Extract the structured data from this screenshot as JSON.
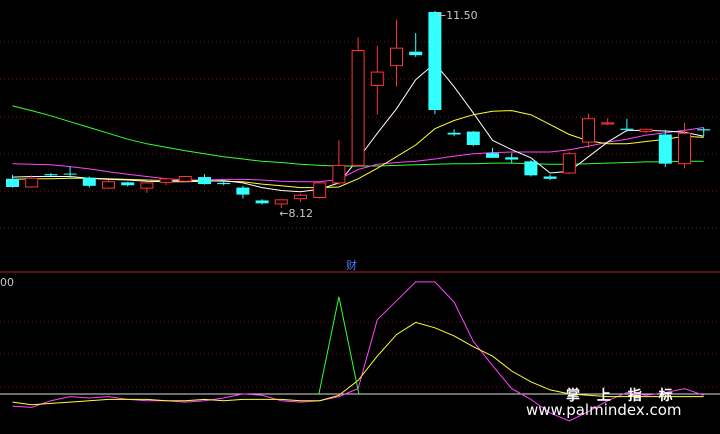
{
  "chart_data": [
    {
      "type": "candlestick",
      "panel": "price",
      "ylim": [
        7.4,
        11.6
      ],
      "grid": true,
      "annotations": {
        "high_label": "11.50",
        "high_value": 11.5,
        "low_label": "8.12",
        "low_value": 8.12,
        "marker_text": "财"
      },
      "candles": [
        {
          "o": 8.62,
          "h": 8.69,
          "l": 8.47,
          "c": 8.48,
          "up": false
        },
        {
          "o": 8.48,
          "h": 8.68,
          "l": 8.47,
          "c": 8.63,
          "up": true
        },
        {
          "o": 8.7,
          "h": 8.72,
          "l": 8.66,
          "c": 8.68,
          "up": false
        },
        {
          "o": 8.71,
          "h": 8.83,
          "l": 8.63,
          "c": 8.7,
          "up": false
        },
        {
          "o": 8.64,
          "h": 8.66,
          "l": 8.47,
          "c": 8.5,
          "up": false
        },
        {
          "o": 8.46,
          "h": 8.6,
          "l": 8.45,
          "c": 8.57,
          "up": true
        },
        {
          "o": 8.56,
          "h": 8.57,
          "l": 8.49,
          "c": 8.51,
          "up": false
        },
        {
          "o": 8.46,
          "h": 8.56,
          "l": 8.38,
          "c": 8.55,
          "up": true
        },
        {
          "o": 8.56,
          "h": 8.64,
          "l": 8.51,
          "c": 8.62,
          "up": true
        },
        {
          "o": 8.58,
          "h": 8.67,
          "l": 8.56,
          "c": 8.66,
          "up": true
        },
        {
          "o": 8.65,
          "h": 8.7,
          "l": 8.52,
          "c": 8.53,
          "up": false
        },
        {
          "o": 8.55,
          "h": 8.6,
          "l": 8.51,
          "c": 8.53,
          "up": false
        },
        {
          "o": 8.47,
          "h": 8.5,
          "l": 8.28,
          "c": 8.35,
          "up": false
        },
        {
          "o": 8.25,
          "h": 8.27,
          "l": 8.18,
          "c": 8.2,
          "up": false
        },
        {
          "o": 8.19,
          "h": 8.27,
          "l": 8.12,
          "c": 8.26,
          "up": true
        },
        {
          "o": 8.28,
          "h": 8.36,
          "l": 8.22,
          "c": 8.34,
          "up": true
        },
        {
          "o": 8.3,
          "h": 8.57,
          "l": 8.28,
          "c": 8.55,
          "up": true
        },
        {
          "o": 8.55,
          "h": 9.28,
          "l": 8.52,
          "c": 8.85,
          "up": true
        },
        {
          "o": 8.85,
          "h": 11.05,
          "l": 8.85,
          "c": 10.82,
          "up": true
        },
        {
          "o": 10.22,
          "h": 10.9,
          "l": 9.72,
          "c": 10.45,
          "up": true
        },
        {
          "o": 10.56,
          "h": 11.35,
          "l": 10.2,
          "c": 10.86,
          "up": true
        },
        {
          "o": 10.8,
          "h": 11.12,
          "l": 10.71,
          "c": 10.74,
          "up": false
        },
        {
          "o": 11.48,
          "h": 11.5,
          "l": 9.73,
          "c": 9.8,
          "up": false
        },
        {
          "o": 9.41,
          "h": 9.47,
          "l": 9.35,
          "c": 9.38,
          "up": false
        },
        {
          "o": 9.43,
          "h": 9.44,
          "l": 9.18,
          "c": 9.2,
          "up": false
        },
        {
          "o": 9.06,
          "h": 9.15,
          "l": 8.98,
          "c": 8.98,
          "up": false
        },
        {
          "o": 8.99,
          "h": 9.06,
          "l": 8.88,
          "c": 8.95,
          "up": false
        },
        {
          "o": 8.92,
          "h": 8.94,
          "l": 8.66,
          "c": 8.68,
          "up": false
        },
        {
          "o": 8.66,
          "h": 8.69,
          "l": 8.6,
          "c": 8.62,
          "up": false
        },
        {
          "o": 8.72,
          "h": 9.08,
          "l": 8.7,
          "c": 9.05,
          "up": true
        },
        {
          "o": 9.25,
          "h": 9.74,
          "l": 9.15,
          "c": 9.65,
          "up": true
        },
        {
          "o": 9.58,
          "h": 9.66,
          "l": 9.54,
          "c": 9.56,
          "up": true
        },
        {
          "o": 9.48,
          "h": 9.65,
          "l": 9.43,
          "c": 9.46,
          "up": false
        },
        {
          "o": 9.43,
          "h": 9.48,
          "l": 9.4,
          "c": 9.47,
          "up": true
        },
        {
          "o": 9.38,
          "h": 9.46,
          "l": 8.82,
          "c": 8.88,
          "up": false
        },
        {
          "o": 8.88,
          "h": 9.58,
          "l": 8.8,
          "c": 9.4,
          "up": true
        },
        {
          "o": 9.47,
          "h": 9.5,
          "l": 9.35,
          "c": 9.45,
          "up": false
        }
      ],
      "lines": [
        {
          "color": "#ffffff",
          "values": [
            8.65,
            8.66,
            8.66,
            8.66,
            8.63,
            8.61,
            8.6,
            8.58,
            8.57,
            8.57,
            8.58,
            8.59,
            8.55,
            8.47,
            8.42,
            8.4,
            8.44,
            8.55,
            8.96,
            9.4,
            9.82,
            10.32,
            10.6,
            10.2,
            9.75,
            9.28,
            9.12,
            8.98,
            8.72,
            8.75,
            9.0,
            9.25,
            9.45,
            9.45,
            9.44,
            9.42,
            9.35
          ]
        },
        {
          "color": "#ffff33",
          "values": [
            8.61,
            8.62,
            8.62,
            8.63,
            8.63,
            8.62,
            8.61,
            8.6,
            8.59,
            8.59,
            8.59,
            8.58,
            8.57,
            8.53,
            8.5,
            8.47,
            8.47,
            8.48,
            8.62,
            8.8,
            9.0,
            9.2,
            9.48,
            9.62,
            9.72,
            9.78,
            9.79,
            9.72,
            9.55,
            9.38,
            9.27,
            9.22,
            9.22,
            9.26,
            9.3,
            9.35,
            9.33
          ]
        },
        {
          "color": "#ff44ff",
          "values": [
            8.88,
            8.87,
            8.86,
            8.83,
            8.79,
            8.74,
            8.7,
            8.66,
            8.62,
            8.6,
            8.6,
            8.61,
            8.61,
            8.6,
            8.58,
            8.57,
            8.57,
            8.61,
            8.78,
            8.87,
            8.9,
            8.92,
            8.96,
            9.01,
            9.05,
            9.07,
            9.08,
            9.08,
            9.08,
            9.12,
            9.18,
            9.25,
            9.3,
            9.37,
            9.41,
            9.45,
            9.5
          ]
        },
        {
          "color": "#33ff33",
          "values": [
            9.87,
            9.79,
            9.7,
            9.6,
            9.5,
            9.4,
            9.3,
            9.22,
            9.16,
            9.1,
            9.05,
            9.0,
            8.96,
            8.92,
            8.9,
            8.87,
            8.85,
            8.84,
            8.84,
            8.84,
            8.85,
            8.86,
            8.87,
            8.88,
            8.88,
            8.89,
            8.89,
            8.88,
            8.87,
            8.87,
            8.88,
            8.89,
            8.9,
            8.91,
            8.91,
            8.92,
            8.92
          ]
        }
      ]
    },
    {
      "type": "line",
      "panel": "indicator",
      "top_label": "00",
      "ylim": [
        0,
        100
      ],
      "series": [
        {
          "color": "#ff44ff",
          "values": [
            14,
            13,
            18,
            21,
            20,
            21,
            19,
            18,
            18,
            17,
            18,
            20,
            23,
            22,
            18,
            17,
            18,
            21,
            27,
            78,
            92,
            106,
            106,
            91,
            62,
            44,
            27,
            19,
            9,
            3,
            10,
            18,
            24,
            22,
            24,
            27,
            22
          ]
        },
        {
          "color": "#ffff33",
          "values": [
            17,
            15,
            16,
            17,
            18,
            19,
            19,
            19,
            18,
            18,
            19,
            18,
            19,
            19,
            19,
            18,
            18,
            22,
            33,
            51,
            67,
            76,
            72,
            66,
            58,
            51,
            40,
            32,
            26,
            23,
            22,
            21,
            21,
            21,
            21,
            21,
            21
          ]
        },
        {
          "color": "#33ff33",
          "values": [
            null,
            null,
            null,
            null,
            null,
            null,
            null,
            null,
            null,
            null,
            null,
            null,
            null,
            null,
            null,
            null,
            null,
            23,
            null,
            null,
            null,
            null,
            null,
            null,
            null,
            null,
            null,
            null,
            null,
            null,
            null,
            null,
            null,
            null,
            null,
            null,
            null
          ],
          "spike": {
            "index": 17,
            "from": 23,
            "to": 95
          }
        }
      ],
      "flat_line": {
        "value": 23,
        "color": "#dddddd"
      }
    }
  ],
  "watermark": {
    "cn": "掌 上 指 标",
    "url": "www.palmindex.com"
  }
}
